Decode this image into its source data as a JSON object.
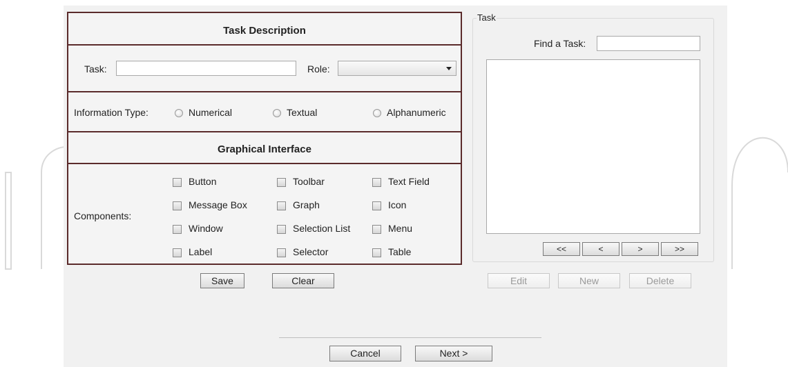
{
  "task_description": {
    "title": "Task Description",
    "task_label": "Task:",
    "task_value": "",
    "role_label": "Role:",
    "role_value": ""
  },
  "information_type": {
    "label": "Information Type:",
    "options": [
      "Numerical",
      "Textual",
      "Alphanumeric"
    ]
  },
  "graphical_interface": {
    "title": "Graphical Interface",
    "components_label": "Components:",
    "components": [
      [
        "Button",
        "Toolbar",
        "Text Field"
      ],
      [
        "Message Box",
        "Graph",
        "Icon"
      ],
      [
        "Window",
        "Selection List",
        "Menu"
      ],
      [
        "Label",
        "Selector",
        "Table"
      ]
    ]
  },
  "form_buttons": {
    "save": "Save",
    "clear": "Clear"
  },
  "task_panel": {
    "legend": "Task",
    "find_label": "Find a Task:",
    "find_value": "",
    "nav": [
      "<<",
      "<",
      ">",
      ">>"
    ],
    "actions": {
      "edit": "Edit",
      "new": "New",
      "delete": "Delete"
    }
  },
  "footer": {
    "cancel": "Cancel",
    "next": "Next >"
  }
}
